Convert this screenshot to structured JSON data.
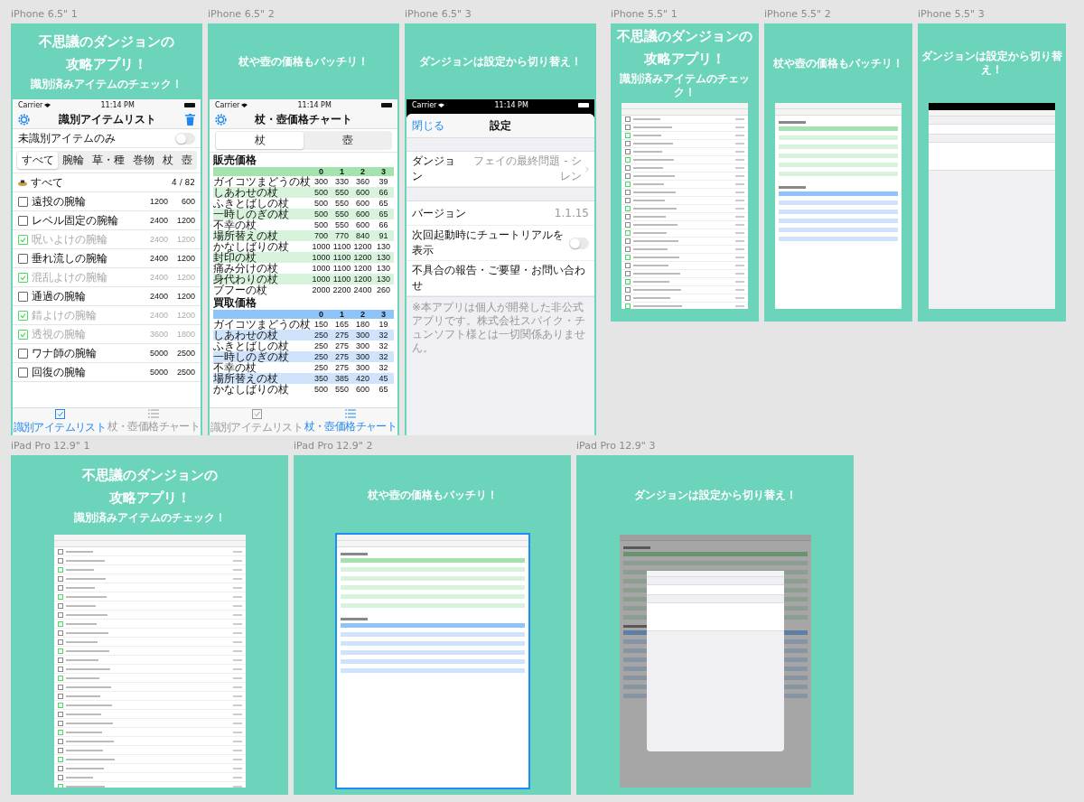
{
  "canvas": {
    "rows": [
      {
        "groups": [
          {
            "frames": [
              {
                "label": "iPhone 6.5\" 1",
                "selected": false,
                "title": [
                  "不思議のダンジョンの",
                  "攻略アプリ！"
                ],
                "subtitle": "識別済みアイテムのチェック！",
                "screen": {
                  "kind": "list",
                  "carrier": "Carrier",
                  "time": "11:14 PM",
                  "nav_title": "識別アイテムリスト",
                  "filter": {
                    "label": "未識別アイテムのみ",
                    "on": false
                  },
                  "segments": [
                    {
                      "label": "すべて",
                      "selected": true
                    },
                    {
                      "label": "腕輪",
                      "selected": false
                    },
                    {
                      "label": "草・種",
                      "selected": false
                    },
                    {
                      "label": "巻物",
                      "selected": false
                    },
                    {
                      "label": "杖",
                      "selected": false
                    },
                    {
                      "label": "壺",
                      "selected": false
                    }
                  ],
                  "group": {
                    "label": "すべて",
                    "count": "4 / 82"
                  },
                  "items": [
                    {
                      "name": "遠投の腕輪",
                      "buy": "1200",
                      "sell": "600",
                      "checked": false
                    },
                    {
                      "name": "レベル固定の腕輪",
                      "buy": "2400",
                      "sell": "1200",
                      "checked": false
                    },
                    {
                      "name": "呪いよけの腕輪",
                      "buy": "2400",
                      "sell": "1200",
                      "checked": true
                    },
                    {
                      "name": "垂れ流しの腕輪",
                      "buy": "2400",
                      "sell": "1200",
                      "checked": false
                    },
                    {
                      "name": "混乱よけの腕輪",
                      "buy": "2400",
                      "sell": "1200",
                      "checked": true
                    },
                    {
                      "name": "通過の腕輪",
                      "buy": "2400",
                      "sell": "1200",
                      "checked": false
                    },
                    {
                      "name": "錆よけの腕輪",
                      "buy": "2400",
                      "sell": "1200",
                      "checked": true
                    },
                    {
                      "name": "透視の腕輪",
                      "buy": "3600",
                      "sell": "1800",
                      "checked": true
                    },
                    {
                      "name": "ワナ師の腕輪",
                      "buy": "5000",
                      "sell": "2500",
                      "checked": false
                    },
                    {
                      "name": "回復の腕輪",
                      "buy": "5000",
                      "sell": "2500",
                      "checked": false
                    }
                  ],
                  "tabs": [
                    {
                      "label": "識別アイテムリスト",
                      "selected": true
                    },
                    {
                      "label": "杖・壺価格チャート",
                      "selected": false
                    }
                  ]
                }
              },
              {
                "label": "iPhone 6.5\" 2",
                "selected": false,
                "subtitle": "杖や壺の価格もバッチリ！",
                "screen": {
                  "kind": "chart",
                  "carrier": "Carrier",
                  "time": "11:14 PM",
                  "nav_title": "杖・壺価格チャート",
                  "segments": [
                    {
                      "label": "杖",
                      "selected": true
                    },
                    {
                      "label": "壺",
                      "selected": false
                    }
                  ],
                  "sections": [
                    {
                      "title": "販売価格",
                      "kind": "sell",
                      "columns": [
                        "0",
                        "1",
                        "2",
                        "3"
                      ],
                      "rows": [
                        {
                          "name": "ガイコツまどうの杖",
                          "values": [
                            "300",
                            "330",
                            "360",
                            "39"
                          ]
                        },
                        {
                          "name": "しあわせの杖",
                          "values": [
                            "500",
                            "550",
                            "600",
                            "66"
                          ]
                        },
                        {
                          "name": "ふきとばしの杖",
                          "values": [
                            "500",
                            "550",
                            "600",
                            "65"
                          ]
                        },
                        {
                          "name": "一時しのぎの杖",
                          "values": [
                            "500",
                            "550",
                            "600",
                            "65"
                          ]
                        },
                        {
                          "name": "不幸の杖",
                          "values": [
                            "500",
                            "550",
                            "600",
                            "66"
                          ]
                        },
                        {
                          "name": "場所替えの杖",
                          "values": [
                            "700",
                            "770",
                            "840",
                            "91"
                          ]
                        },
                        {
                          "name": "かなしばりの杖",
                          "values": [
                            "1000",
                            "1100",
                            "1200",
                            "130"
                          ]
                        },
                        {
                          "name": "封印の杖",
                          "values": [
                            "1000",
                            "1100",
                            "1200",
                            "130"
                          ]
                        },
                        {
                          "name": "痛み分けの杖",
                          "values": [
                            "1000",
                            "1100",
                            "1200",
                            "130"
                          ]
                        },
                        {
                          "name": "身代わりの杖",
                          "values": [
                            "1000",
                            "1100",
                            "1200",
                            "130"
                          ]
                        },
                        {
                          "name": "ブフーの杖",
                          "values": [
                            "2000",
                            "2200",
                            "2400",
                            "260"
                          ]
                        }
                      ]
                    },
                    {
                      "title": "買取価格",
                      "kind": "buy",
                      "columns": [
                        "0",
                        "1",
                        "2",
                        "3"
                      ],
                      "rows": [
                        {
                          "name": "ガイコツまどうの杖",
                          "values": [
                            "150",
                            "165",
                            "180",
                            "19"
                          ]
                        },
                        {
                          "name": "しあわせの杖",
                          "values": [
                            "250",
                            "275",
                            "300",
                            "32"
                          ]
                        },
                        {
                          "name": "ふきとばしの杖",
                          "values": [
                            "250",
                            "275",
                            "300",
                            "32"
                          ]
                        },
                        {
                          "name": "一時しのぎの杖",
                          "values": [
                            "250",
                            "275",
                            "300",
                            "32"
                          ]
                        },
                        {
                          "name": "不幸の杖",
                          "values": [
                            "250",
                            "275",
                            "300",
                            "32"
                          ]
                        },
                        {
                          "name": "場所替えの杖",
                          "values": [
                            "350",
                            "385",
                            "420",
                            "45"
                          ]
                        },
                        {
                          "name": "かなしばりの杖",
                          "values": [
                            "500",
                            "550",
                            "600",
                            "65"
                          ]
                        }
                      ]
                    }
                  ],
                  "tabs": [
                    {
                      "label": "識別アイテムリスト",
                      "selected": false
                    },
                    {
                      "label": "杖・壺価格チャート",
                      "selected": true
                    }
                  ]
                }
              },
              {
                "label": "iPhone 6.5\" 3",
                "selected": false,
                "subtitle": "ダンジョンは設定から切り替え！",
                "screen": {
                  "kind": "settings",
                  "carrier": "Carrier",
                  "time": "11:14 PM",
                  "close": "閉じる",
                  "nav_title": "設定",
                  "groups": [
                    [
                      {
                        "kind": "value",
                        "label": "ダンジョン",
                        "value": "フェイの最終問題 - シレン",
                        "chevron": true
                      }
                    ],
                    [
                      {
                        "kind": "value",
                        "label": "バージョン",
                        "value": "1.1.15",
                        "chevron": false
                      },
                      {
                        "kind": "toggle",
                        "label": "次回起動時にチュートリアルを表示",
                        "on": false
                      },
                      {
                        "kind": "link",
                        "label": "不具合の報告・ご要望・お問い合わせ"
                      }
                    ]
                  ],
                  "note": "※本アプリは個人が開発した非公式アプリです。株式会社スパイク・チュンソフト様とは一切関係ありません。"
                }
              }
            ]
          },
          {
            "frames": [
              {
                "label": "iPhone 5.5\" 1",
                "selected": false,
                "title": [
                  "不思議のダンジョンの",
                  "攻略アプリ！"
                ],
                "subtitle": "識別済みアイテムのチェック！",
                "screen": {
                  "kind": "list_mini"
                }
              },
              {
                "label": "iPhone 5.5\" 2",
                "selected": false,
                "subtitle": "杖や壺の価格もバッチリ！",
                "screen": {
                  "kind": "chart_mini"
                }
              },
              {
                "label": "iPhone 5.5\" 3",
                "selected": false,
                "subtitle": "ダンジョンは設定から切り替え！",
                "screen": {
                  "kind": "settings_mini"
                }
              }
            ]
          }
        ]
      },
      {
        "groups": [
          {
            "frames": [
              {
                "label": "iPad Pro 12.9\" 1",
                "selected": false,
                "title": [
                  "不思議のダンジョンの",
                  "攻略アプリ！"
                ],
                "subtitle": "識別済みアイテムのチェック！",
                "screen": {
                  "kind": "list_mini"
                }
              },
              {
                "label": "iPad Pro 12.9\" 2",
                "selected": true,
                "subtitle": "杖や壺の価格もバッチリ！",
                "screen": {
                  "kind": "chart_mini"
                }
              },
              {
                "label": "iPad Pro 12.9\" 3",
                "selected": false,
                "subtitle": "ダンジョンは設定から切り替え！",
                "screen": {
                  "kind": "settings_modal_mini"
                }
              }
            ]
          }
        ]
      }
    ]
  }
}
